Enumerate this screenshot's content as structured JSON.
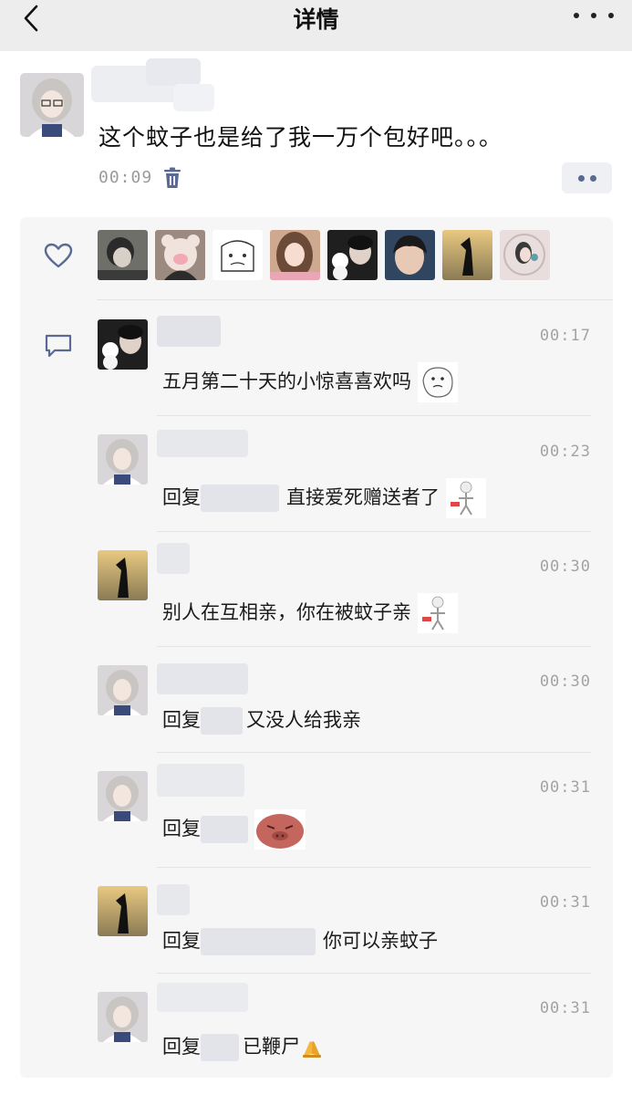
{
  "header": {
    "title": "详情",
    "back_icon": "chevron-left-icon",
    "more_icon": "more-dots-icon"
  },
  "post": {
    "text": "这个蚊子也是给了我一万个包好吧。。。",
    "time": "00:09",
    "delete_icon": "trash-icon",
    "action_icon": "more-actions-icon"
  },
  "likes": {
    "icon": "heart-icon",
    "count_avatars": 8
  },
  "comments_icon": "comment-bubble-icon",
  "comments": [
    {
      "time": "00:17",
      "prefix": "",
      "text": "五月第二十天的小惊喜喜欢吗",
      "sticker": "face-sticker-icon"
    },
    {
      "time": "00:23",
      "prefix": "回复",
      "text": "直接爱死赠送者了",
      "sticker": "smiling-figure-sticker-icon"
    },
    {
      "time": "00:30",
      "prefix": "",
      "text": "别人在互相亲，你在被蚊子亲",
      "sticker": "smiling-figure-sticker-icon"
    },
    {
      "time": "00:30",
      "prefix": "回复",
      "text": "又没人给我亲",
      "sticker": ""
    },
    {
      "time": "00:31",
      "prefix": "回复",
      "text": "",
      "sticker": "pig-face-sticker-icon"
    },
    {
      "time": "00:31",
      "prefix": "回复",
      "text": "你可以亲蚊子",
      "sticker": ""
    },
    {
      "time": "00:31",
      "prefix": "回复",
      "text": "已鞭尸",
      "sticker": "praying-hands-emoji-icon"
    }
  ],
  "colors": {
    "header_bg": "#ededed",
    "panel_bg": "#f6f6f6",
    "link_blue": "#59698f",
    "meta_gray": "#9a9a9a"
  }
}
